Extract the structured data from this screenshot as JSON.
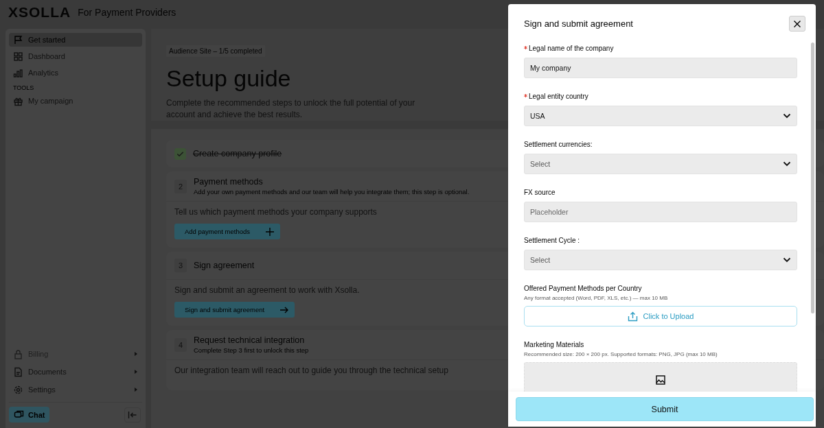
{
  "header": {
    "logo": "XSOLLA",
    "subtitle": "For Payment Providers"
  },
  "sidebar": {
    "items": [
      {
        "label": "Get started",
        "selected": true,
        "disabled": false,
        "submenu": false
      },
      {
        "label": "Dashboard",
        "selected": false,
        "disabled": false,
        "submenu": false
      },
      {
        "label": "Analytics",
        "selected": false,
        "disabled": false,
        "submenu": false
      }
    ],
    "section": "TOOLS",
    "tools": [
      {
        "label": "My campaign",
        "selected": false,
        "disabled": false,
        "submenu": false
      }
    ],
    "bottom_items": [
      {
        "label": "Billing",
        "selected": false,
        "disabled": true,
        "submenu": true
      },
      {
        "label": "Documents",
        "selected": false,
        "disabled": false,
        "submenu": true
      },
      {
        "label": "Settings",
        "selected": false,
        "disabled": false,
        "submenu": true
      }
    ],
    "chat": "Chat"
  },
  "main": {
    "badge": "Audience Site – 1/5 completed",
    "title": "Setup guide",
    "description": "Complete the recommended steps to unlock the full potential of your account and achieve the best results.",
    "steps": [
      {
        "title": "Create company profile",
        "done": true
      },
      {
        "number": "2",
        "title": "Payment methods",
        "subtitle": "Add your own payment methods and our team will help you integrate them; this step is optional.",
        "done": false,
        "body": "Tell us which payment methods your company supports",
        "action": "Add payment methods"
      },
      {
        "number": "3",
        "title": "Sign agreement",
        "done": false,
        "body": "Sign and submit an agreement to work with Xsolla.",
        "action": "Sign and submit agreement"
      },
      {
        "number": "4",
        "title": "Request technical integration",
        "subtitle": "Complete Step 3 first to unlock this step",
        "done": false,
        "body": "Our integration team will reach out to guide you through the technical setup"
      }
    ]
  },
  "drawer": {
    "title": "Sign and submit agreement",
    "fields": [
      {
        "kind": "text",
        "label": "Legal name of the company",
        "required": true,
        "value": "My company"
      },
      {
        "kind": "select",
        "label": "Legal entity country",
        "required": true,
        "value": "USA"
      },
      {
        "kind": "select",
        "label": "Settlement currencies:",
        "required": false,
        "placeholder": "Select"
      },
      {
        "kind": "text",
        "label": "FX source",
        "required": false,
        "placeholder": "Placeholder"
      },
      {
        "kind": "select",
        "label": "Settlement Cycle :",
        "required": false,
        "placeholder": "Select"
      },
      {
        "kind": "upload",
        "label": "Offered Payment Methods per Country",
        "required": false,
        "hint": "Any format accepted (Word, PDF, XLS, etc.) — max 10 MB",
        "button": "Click to Upload"
      },
      {
        "kind": "image",
        "label": "Marketing Materials",
        "required": false,
        "hint": "Recommended size: 200 × 200 px. Supported formats: PNG, JPG (max 10 MB)"
      }
    ],
    "submit": "Submit"
  }
}
